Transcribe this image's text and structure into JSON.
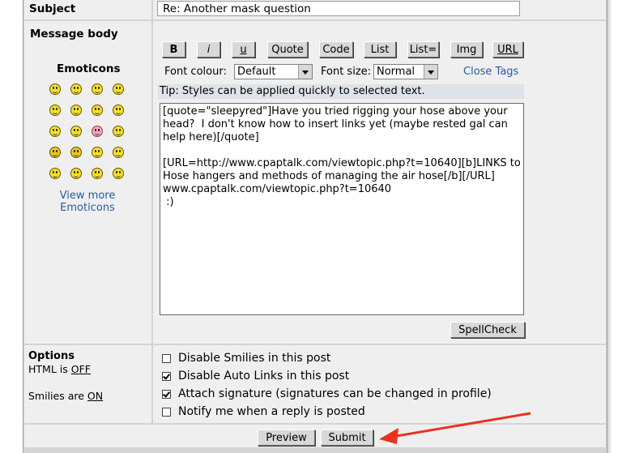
{
  "subject": {
    "label": "Subject",
    "value": "Re: Another mask question"
  },
  "message_body": {
    "label": "Message body",
    "emoticons_title": "Emoticons",
    "view_more": "View more",
    "view_more_2": "Emoticons"
  },
  "toolbar": {
    "buttons": [
      "B",
      "i",
      "u",
      "Quote",
      "Code",
      "List",
      "List=",
      "Img",
      "URL"
    ],
    "font_colour_label": "Font colour:",
    "font_colour_value": "Default",
    "font_size_label": "Font size:",
    "font_size_value": "Normal",
    "close_tags": "Close Tags",
    "tip": "Tip: Styles can be applied quickly to selected text."
  },
  "message_text": "[quote=\"sleepyred\"]Have you tried rigging your hose above your head?  I don't know how to insert links yet (maybe rested gal can help here)[/quote]\n\n[URL=http://www.cpaptalk.com/viewtopic.php?t=10640][b]LINKS to Hose hangers and methods of managing the air hose[/b][/URL]\nwww.cpaptalk.com/viewtopic.php?t=10640\n :)",
  "spellcheck_label": "SpellCheck",
  "options": {
    "title": "Options",
    "html_label": "HTML is",
    "html_state": "OFF",
    "smilies_label": "Smilies are",
    "smilies_state": "ON",
    "items": [
      {
        "label": "Disable Smilies in this post",
        "checked": false
      },
      {
        "label": "Disable Auto Links in this post",
        "checked": true
      },
      {
        "label": "Attach signature (signatures can be changed in profile)",
        "checked": true
      },
      {
        "label": "Notify me when a reply is posted",
        "checked": false
      }
    ]
  },
  "actions": {
    "preview": "Preview",
    "submit": "Submit"
  },
  "colors": {
    "arrow": "#e8321e",
    "link": "#2a5aa0"
  }
}
